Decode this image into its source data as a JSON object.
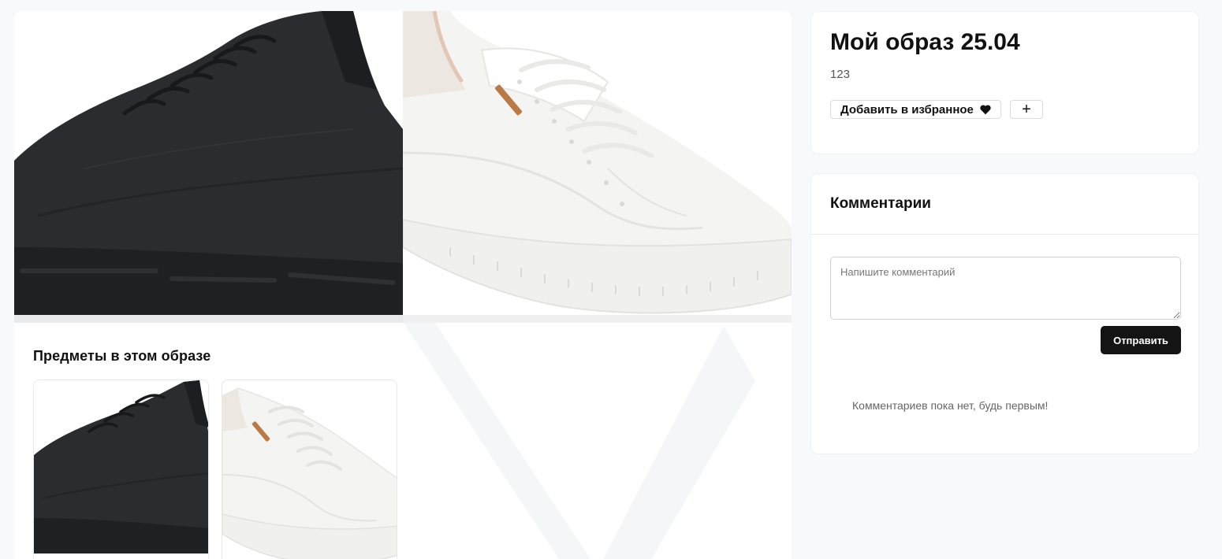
{
  "look": {
    "title": "Мой образ 25.04",
    "description": "123",
    "items_title": "Предметы в этом образе",
    "hero_images": [
      {
        "icon": "black-sneaker-image"
      },
      {
        "icon": "white-sneaker-image"
      }
    ],
    "items": [
      {
        "icon": "black-sneaker-thumbnail"
      },
      {
        "icon": "white-sneaker-thumbnail"
      }
    ]
  },
  "actions": {
    "favorite_label": "Добавить в избранное",
    "favorite_icon": "heart-icon",
    "add_label": "+"
  },
  "comments": {
    "title": "Комментарии",
    "placeholder": "Напишите комментарий",
    "submit_label": "Отправить",
    "empty_text": "Комментариев пока нет, будь первым!"
  },
  "colors": {
    "page_bg": "#f8f9fb",
    "card_bg": "#ffffff",
    "button_dark": "#141414",
    "sneaker_black": "#2a2b2e",
    "sole_accent": "#b97a45"
  }
}
